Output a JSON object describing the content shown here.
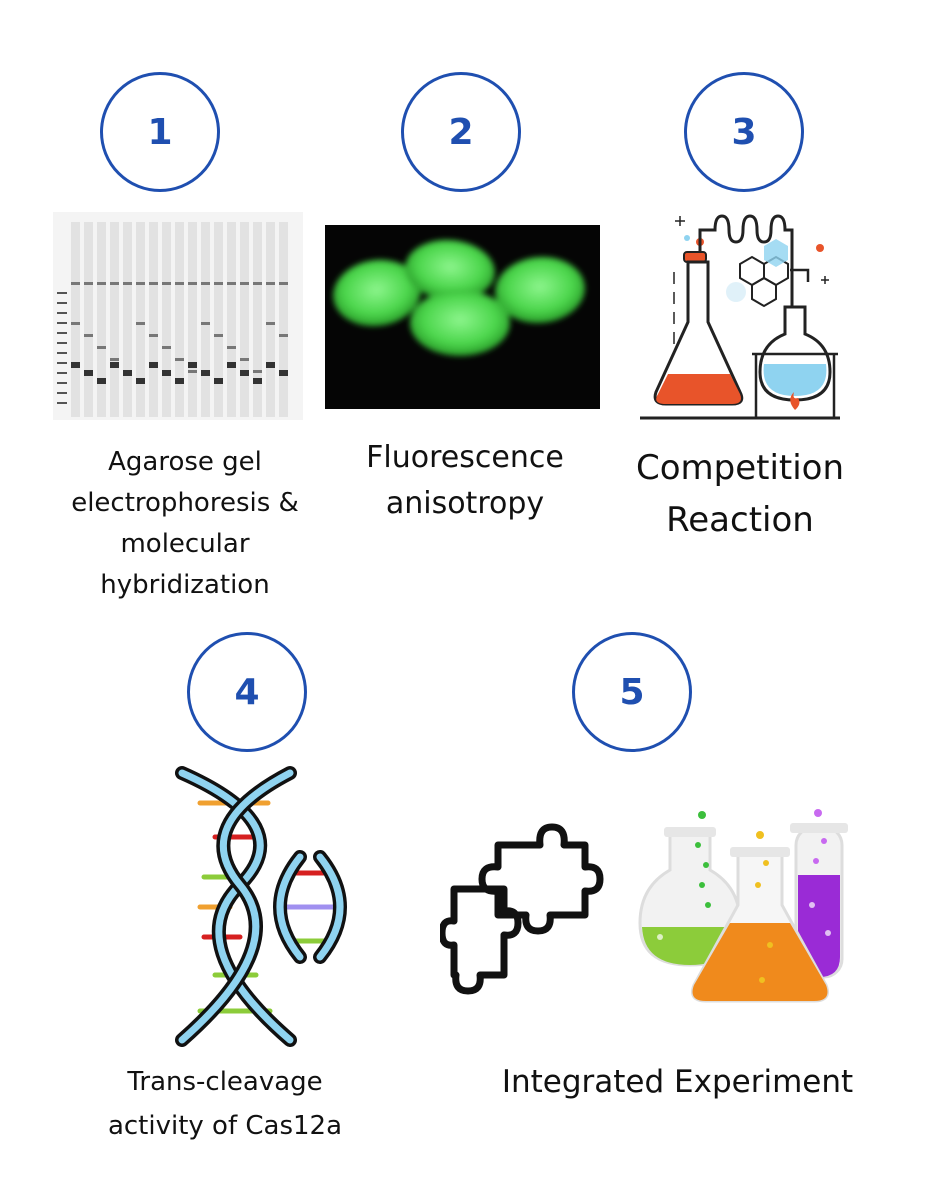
{
  "steps": [
    {
      "number": "1",
      "caption_lines": [
        "Agarose gel",
        "electrophoresis &",
        "molecular",
        "hybridization"
      ],
      "illustration": "gel-electrophoresis-image"
    },
    {
      "number": "2",
      "caption_lines": [
        "Fluorescence",
        "anisotropy"
      ],
      "illustration": "fluorescent-beads-image"
    },
    {
      "number": "3",
      "caption_lines": [
        "Competition",
        "Reaction"
      ],
      "illustration": "chemistry-lab-icon"
    },
    {
      "number": "4",
      "caption_lines": [
        "Trans-cleavage",
        "activity of Cas12a"
      ],
      "illustration": "dna-cleavage-icon"
    },
    {
      "number": "5",
      "caption_lines": [
        "Integrated Experiment"
      ],
      "illustration": "puzzle-and-flasks-icon"
    }
  ],
  "colors": {
    "badge": "#1f4fb0",
    "fluorescence": "#4cd64c",
    "flask_red": "#e8542a",
    "flask_blue": "#8fd3f0",
    "flask_green": "#8ccc3a",
    "flask_orange": "#f08a1c",
    "flask_purple": "#9a2bd6"
  }
}
